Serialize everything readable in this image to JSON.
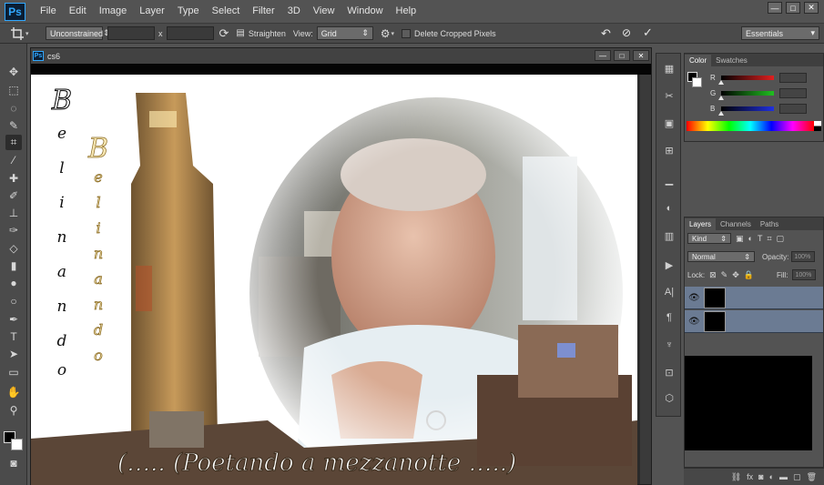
{
  "app": {
    "logo": "Ps",
    "menu": [
      "File",
      "Edit",
      "Image",
      "Layer",
      "Type",
      "Select",
      "Filter",
      "3D",
      "View",
      "Window",
      "Help"
    ],
    "window_controls": {
      "minimize": "—",
      "maximize": "□",
      "close": "✕"
    }
  },
  "options_bar": {
    "crop_icon": "crop-icon",
    "ratio_select": "Unconstrained",
    "times_label": "x",
    "straighten_label": "Straighten",
    "view_label": "View:",
    "view_select": "Grid",
    "delete_cropped_label": "Delete Cropped Pixels",
    "workspace_select": "Essentials"
  },
  "document": {
    "icon": "Ps",
    "name": "cs6",
    "artwork": {
      "vertical_text_left": [
        "B",
        "e",
        "l",
        "i",
        "n",
        "a",
        "n",
        "d",
        "o"
      ],
      "vertical_text_gold": [
        "B",
        "e",
        "l",
        "i",
        "n",
        "a",
        "n",
        "d",
        "o"
      ],
      "caption": "(….. (Poetando a mezzanotte …..)"
    }
  },
  "color_panel": {
    "tabs": [
      "Color",
      "Swatches"
    ],
    "channels": [
      {
        "letter": "R",
        "color": "#e02020"
      },
      {
        "letter": "G",
        "color": "#20c020"
      },
      {
        "letter": "B",
        "color": "#2030e0"
      }
    ]
  },
  "layers_panel": {
    "tabs": [
      "Layers",
      "Channels",
      "Paths"
    ],
    "kind_label": "Kind",
    "blend_mode": "Normal",
    "opacity_label": "Opacity:",
    "opacity_value": "100%",
    "lock_label": "Lock:",
    "fill_label": "Fill:",
    "fill_value": "100%",
    "layer_count": 2
  },
  "colors": {
    "ui_dark": "#535353",
    "layer_selected": "#6b7b93",
    "accent": "#31a8ff"
  }
}
